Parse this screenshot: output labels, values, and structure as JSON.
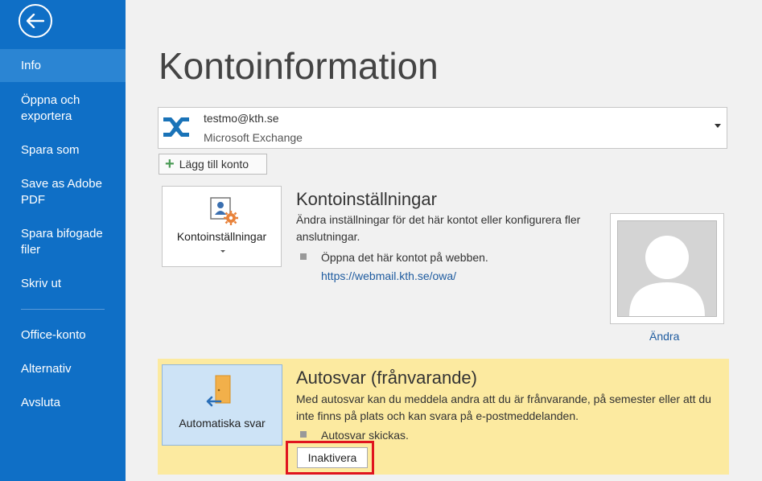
{
  "sidebar": {
    "items": [
      {
        "label": "Info"
      },
      {
        "label": "Öppna och exportera"
      },
      {
        "label": "Spara som"
      },
      {
        "label": "Save as Adobe PDF"
      },
      {
        "label": "Spara bifogade filer"
      },
      {
        "label": "Skriv ut"
      },
      {
        "label": "Office-konto"
      },
      {
        "label": "Alternativ"
      },
      {
        "label": "Avsluta"
      }
    ]
  },
  "main": {
    "title": "Kontoinformation",
    "account": {
      "email": "testmo@kth.se",
      "type": "Microsoft Exchange"
    },
    "add_account_label": "Lägg till konto",
    "account_settings": {
      "button_label": "Kontoinställningar",
      "title": "Kontoinställningar",
      "description": "Ändra inställningar för det här kontot eller konfigurera fler anslutningar.",
      "bullet": "Öppna det här kontot på webben.",
      "link": "https://webmail.kth.se/owa/"
    },
    "profile": {
      "change_label": "Ändra"
    },
    "auto_reply": {
      "button_label": "Automatiska svar",
      "title": "Autosvar (frånvarande)",
      "description": "Med autosvar kan du meddela andra att du är frånvarande, på semester eller att du inte finns på plats och kan svara på e-postmeddelanden.",
      "bullet": "Autosvar skickas.",
      "deactivate_label": "Inaktivera"
    }
  },
  "colors": {
    "sidebar_bg": "#0f6fc6",
    "sidebar_active": "#2b85d3",
    "highlight_panel": "#fceaa0",
    "outline_red": "#e0141e"
  }
}
